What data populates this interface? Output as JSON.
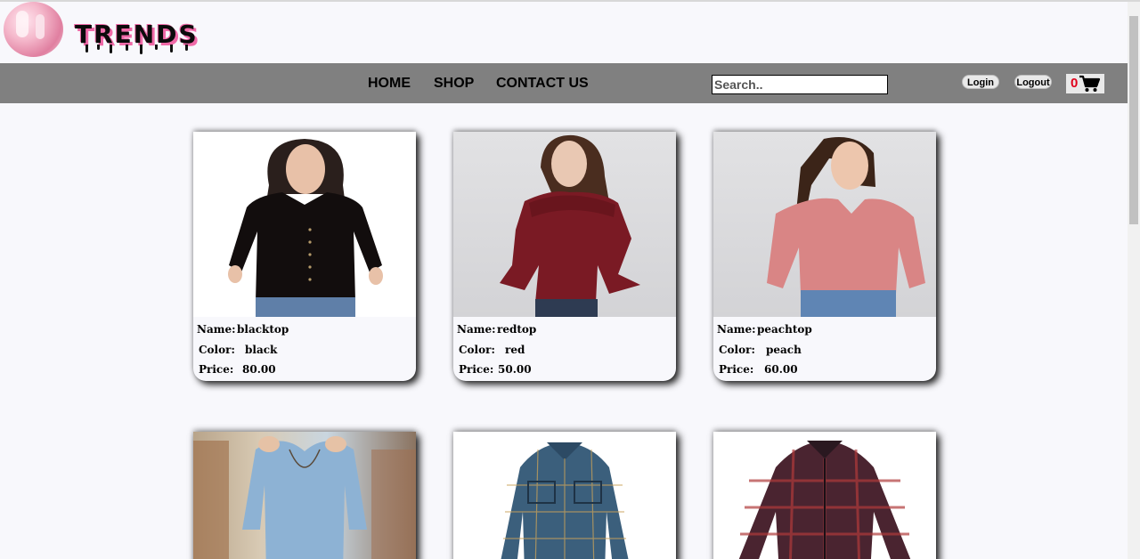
{
  "header": {
    "brand": "TRENDS"
  },
  "nav": {
    "home": "HOME",
    "shop": "SHOP",
    "contact": "CONTACT US",
    "search_placeholder": "Search..",
    "login": "Login",
    "logout": "Logout",
    "cart_count": "0"
  },
  "labels": {
    "name": "Name:",
    "color": "Color:",
    "price": "Price:"
  },
  "products": [
    {
      "name": "blacktop",
      "color": "black",
      "price": "80.00",
      "shirt_color": "#120d0d"
    },
    {
      "name": "redtop",
      "color": "red",
      "price": "50.00",
      "shirt_color": "#7a1a24"
    },
    {
      "name": "peachtop",
      "color": "peach",
      "price": "60.00",
      "shirt_color": "#d98585"
    },
    {
      "shirt_color": "#8db2d4"
    },
    {
      "shirt_color": "#3b5f7c"
    },
    {
      "shirt_color": "#4a2430"
    }
  ]
}
